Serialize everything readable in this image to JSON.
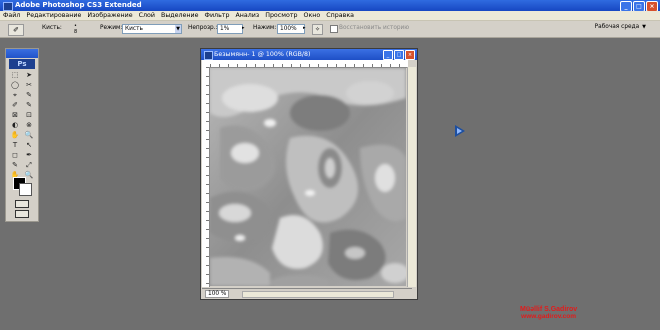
{
  "app": {
    "title": "Adobe Photoshop CS3 Extended",
    "window_buttons": [
      "_",
      "□",
      "×"
    ]
  },
  "menubar": {
    "items": [
      "Файл",
      "Редактирование",
      "Изображение",
      "Слой",
      "Выделение",
      "Фильтр",
      "Анализ",
      "Просмотр",
      "Окно",
      "Справка"
    ]
  },
  "options": {
    "brush_label": "Кисть:",
    "brush_size": "8",
    "mode_label": "Режим:",
    "mode_value": "Кисть",
    "opacity_label": "Непрозр.:",
    "opacity_value": "1%",
    "flow_label": "Нажим:",
    "flow_value": "100%",
    "history_label": "Восстановить историю",
    "workspace_label": "Рабочая среда"
  },
  "tools": {
    "logo": "Ps",
    "icons": [
      "⬚",
      "➤",
      "◯",
      "✂",
      "⌖",
      "✎",
      "✐",
      "✎",
      "⊠",
      "⊡",
      "◐",
      "⊗",
      "✋",
      "🔍",
      "T",
      "↖",
      "◻",
      "✒",
      "✎",
      "⤢",
      "✋",
      "🔍"
    ]
  },
  "document": {
    "title": "Безымянн- 1 @ 100% (RGB/8)",
    "zoom": "100 %",
    "buttons": [
      "_",
      "□",
      "×"
    ]
  },
  "watermark": {
    "line1": "Müəllif S.Gadirov",
    "line2": "www.gadirov.com"
  }
}
